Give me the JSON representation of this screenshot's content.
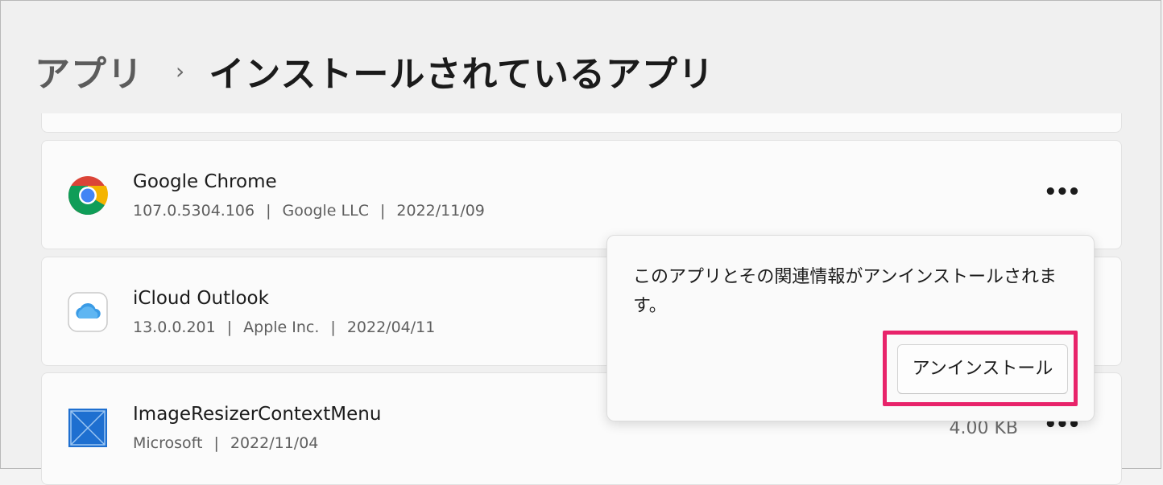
{
  "header": {
    "parent": "アプリ",
    "separator": "›",
    "current": "インストールされているアプリ"
  },
  "apps": [
    {
      "name": "Google Chrome",
      "version": "107.0.5304.106",
      "publisher": "Google LLC",
      "date": "2022/11/09",
      "icon": "chrome-icon"
    },
    {
      "name": "iCloud Outlook",
      "version": "13.0.0.201",
      "publisher": "Apple Inc.",
      "date": "2022/04/11",
      "icon": "icloud-icon"
    },
    {
      "name": "ImageResizerContextMenu",
      "publisher": "Microsoft",
      "date": "2022/11/04",
      "size": "4.00 KB",
      "icon": "image-resizer-icon"
    }
  ],
  "more_label": "•••",
  "meta_separator": "|",
  "flyout": {
    "message": "このアプリとその関連情報がアンインストールされます。",
    "button_label": "アンインストール"
  },
  "colors": {
    "highlight": "#e8236a",
    "image_resizer_blue": "#1e6fd0"
  }
}
